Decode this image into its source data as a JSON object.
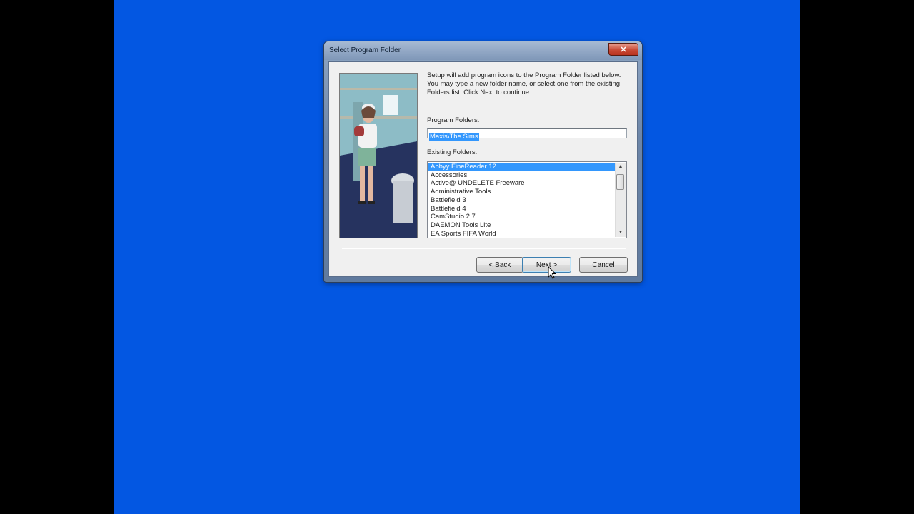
{
  "dialog": {
    "title": "Select Program Folder",
    "close_glyph": "✕",
    "instructions": "Setup will add program icons to the Program Folder listed below. You may type a new folder name, or select one from the existing Folders list.  Click Next to continue.",
    "program_folders_label": "Program Folders:",
    "program_folder_value": "Maxis\\The Sims",
    "existing_folders_label": "Existing Folders:",
    "existing_folders": [
      "Abbyy FineReader 12",
      "Accessories",
      "Active@ UNDELETE Freeware",
      "Administrative Tools",
      "Battlefield 3",
      "Battlefield 4",
      "CamStudio 2.7",
      "DAEMON Tools Lite",
      "EA Sports FIFA World"
    ],
    "selected_index": 0,
    "scroll_up_glyph": "▲",
    "scroll_down_glyph": "▼",
    "buttons": {
      "back": "< Back",
      "next": "Next >",
      "cancel": "Cancel"
    }
  },
  "colors": {
    "desktop": "#0357e2",
    "selection": "#3397fd"
  }
}
